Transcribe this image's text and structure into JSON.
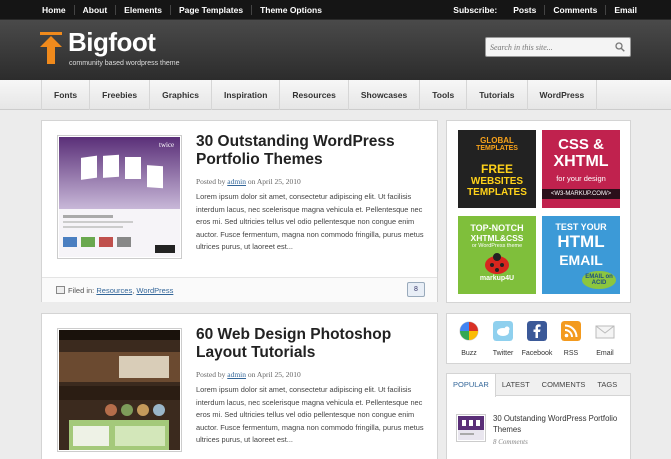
{
  "topnav": {
    "items": [
      "Home",
      "About",
      "Elements",
      "Page Templates",
      "Theme Options"
    ],
    "subscribe": [
      "Subscribe:",
      "Posts",
      "Comments",
      "Email"
    ]
  },
  "header": {
    "title": "Bigfoot",
    "tagline": "community based wordpress theme",
    "search_placeholder": "Search in this site..."
  },
  "catnav": [
    "Fonts",
    "Freebies",
    "Graphics",
    "Inspiration",
    "Resources",
    "Showcases",
    "Tools",
    "Tutorials",
    "WordPress"
  ],
  "posts": [
    {
      "title": "30 Outstanding WordPress Portfolio Themes",
      "posted_by": "Posted by",
      "author": "admin",
      "on": "on April 25, 2010",
      "excerpt": "Lorem ipsum dolor sit amet, consectetur adipiscing elit. Ut facilisis interdum lacus, nec scelerisque magna vehicula et. Pellentesque nec eros mi. Sed ultricies tellus vel odio pellentesque non congue enim auctor. Fusce fermentum, magna non commodo fringilla, purus metus ultrices purus, ut laoreet est...",
      "filed_label": "Filed in:",
      "categories": [
        "Resources",
        "WordPress"
      ],
      "comments": "8",
      "thumb_brand": "twice"
    },
    {
      "title": "60 Web Design Photoshop Layout Tutorials",
      "posted_by": "Posted by",
      "author": "admin",
      "on": "on April 25, 2010",
      "excerpt": "Lorem ipsum dolor sit amet, consectetur adipiscing elit. Ut facilisis interdum lacus, nec scelerisque magna vehicula et. Pellentesque nec eros mi. Sed ultricies tellus vel odio pellentesque non congue enim auctor. Fusce fermentum, magna non commodo fringilla, purus metus ultrices purus, ut laoreet est..."
    }
  ],
  "ads": [
    {
      "lines": [
        "GLOBAL",
        "TEMPLATES",
        "FREE",
        "WEBSITES",
        "TEMPLATES"
      ]
    },
    {
      "lines": [
        "CSS &",
        "XHTML",
        "for your design",
        "<W3-MARKUP.COM/>"
      ]
    },
    {
      "lines": [
        "TOP-NOTCH",
        "XHTML&CSS",
        "or WordPress theme",
        "markup4U"
      ]
    },
    {
      "lines": [
        "TEST YOUR",
        "HTML",
        "EMAIL",
        "EMAIL on ACID"
      ]
    }
  ],
  "social": [
    "Buzz",
    "Twitter",
    "Facebook",
    "RSS",
    "Email"
  ],
  "sidebar_tabs": [
    "POPULAR",
    "LATEST",
    "COMMENTS",
    "TAGS"
  ],
  "popular": {
    "title": "30 Outstanding WordPress Portfolio Themes",
    "comments": "8 Comments"
  },
  "colors": {
    "link": "#336699",
    "topbar": "#151515",
    "logo_arrow": "#f08a1c"
  }
}
